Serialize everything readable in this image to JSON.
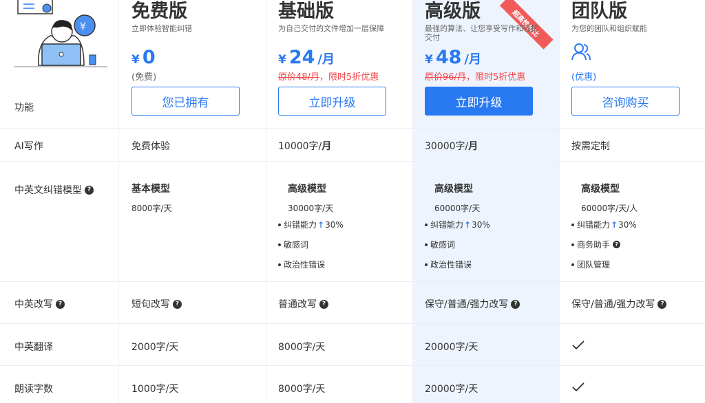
{
  "plans": [
    {
      "title": "免费版",
      "desc": "立即体验智能纠错",
      "currency": "¥",
      "price": "0",
      "unit": "",
      "note": "(免费)",
      "button": "您已拥有"
    },
    {
      "title": "基础版",
      "desc": "为自己交付的文件增加一层保障",
      "currency": "¥",
      "price": "24",
      "unit": "/月",
      "orig_price": "原价48/月",
      "promo": "，限时5折优惠",
      "button": "立即升级"
    },
    {
      "title": "高级版",
      "desc": "最强的算法、让您享受写作和轻松交付",
      "currency": "¥",
      "price": "48",
      "unit": "/月",
      "orig_price": "原价96/月",
      "promo": "，限时5折优惠",
      "button": "立即升级",
      "ribbon": "超高性价比"
    },
    {
      "title": "团队版",
      "desc": "为您的团队和组织赋能",
      "note": "(优惠)",
      "button": "咨询购买",
      "icon": "people-icon"
    }
  ],
  "features_header": "功能",
  "rows": {
    "ai_writing": {
      "label": "AI写作",
      "values": [
        "免费体验",
        "10000字/",
        "30000字/",
        "按需定制"
      ],
      "bold_unit": "月"
    },
    "correction": {
      "label": "中英文纠错模型",
      "cols": [
        {
          "name": "基本模型",
          "limit": "8000字/天",
          "features": []
        },
        {
          "name": "高级模型",
          "limit": "30000字/天",
          "features": [
            "纠错能力",
            "敏感词",
            "政治性错误"
          ],
          "boost": "30%"
        },
        {
          "name": "高级模型",
          "limit": "60000字/天",
          "features": [
            "纠错能力",
            "敏感词",
            "政治性错误"
          ],
          "boost": "30%"
        },
        {
          "name": "高级模型",
          "limit": "60000字/天/人",
          "features": [
            "纠错能力",
            "商务助手",
            "团队管理"
          ],
          "boost": "30%"
        }
      ]
    },
    "rewrite": {
      "label": "中英改写",
      "values": [
        "短句改写",
        "普通改写",
        "保守/普通/强力改写",
        "保守/普通/强力改写"
      ]
    },
    "translate": {
      "label": "中英翻译",
      "values": [
        "2000字/天",
        "8000字/天",
        "20000字/天",
        "check"
      ]
    },
    "read_aloud": {
      "label": "朗读字数",
      "values": [
        "1000字/天",
        "8000字/天",
        "20000字/天",
        "check"
      ]
    }
  },
  "colors": {
    "accent": "#2979f2",
    "promo": "#f5454a",
    "highlight_bg": "#eef4fe"
  }
}
